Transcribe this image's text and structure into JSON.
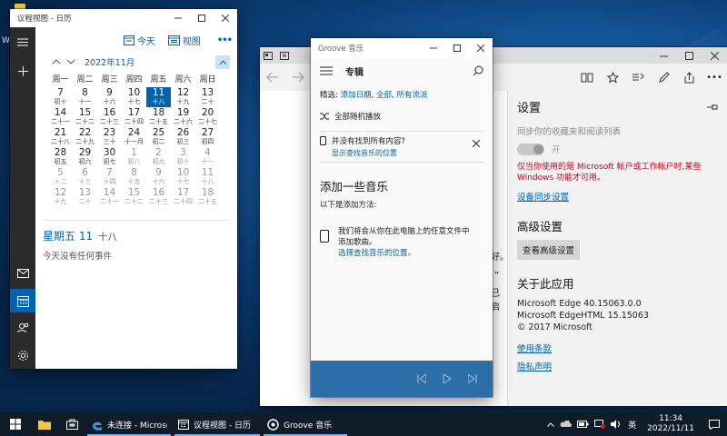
{
  "calendar": {
    "title": "议程视图 - 日历",
    "today_label": "今天",
    "view_label": "视图",
    "more": "•••",
    "month_label": "2022年11月",
    "weekdays": [
      "周一",
      "周二",
      "周三",
      "周四",
      "周五",
      "周六",
      "周日"
    ],
    "weeks": [
      [
        [
          "7",
          "初十",
          0
        ],
        [
          "8",
          "十一",
          0
        ],
        [
          "9",
          "十六",
          0
        ],
        [
          "10",
          "十七",
          0
        ],
        [
          "11",
          "十八",
          1
        ],
        [
          "12",
          "十九",
          0
        ],
        [
          "13",
          "二十",
          0
        ]
      ],
      [
        [
          "14",
          "二十一",
          0
        ],
        [
          "15",
          "二十二",
          0
        ],
        [
          "16",
          "二十三",
          0
        ],
        [
          "17",
          "二十四",
          0
        ],
        [
          "18",
          "二十五",
          0
        ],
        [
          "19",
          "二十六",
          0
        ],
        [
          "20",
          "二十七",
          0
        ]
      ],
      [
        [
          "21",
          "二十八",
          0
        ],
        [
          "22",
          "二十九",
          0
        ],
        [
          "23",
          "三十",
          0
        ],
        [
          "24",
          "十一月",
          0
        ],
        [
          "25",
          "初二",
          0
        ],
        [
          "26",
          "初三",
          0
        ],
        [
          "27",
          "初四",
          0
        ]
      ],
      [
        [
          "28",
          "初五",
          0
        ],
        [
          "29",
          "初六",
          0
        ],
        [
          "30",
          "初七",
          0
        ],
        [
          "1",
          "初八",
          2
        ],
        [
          "2",
          "初九",
          2
        ],
        [
          "3",
          "初十",
          2
        ],
        [
          "4",
          "十一",
          2
        ]
      ],
      [
        [
          "5",
          "十二",
          2
        ],
        [
          "6",
          "十三",
          2
        ],
        [
          "7",
          "十四",
          2
        ],
        [
          "8",
          "十五",
          2
        ],
        [
          "9",
          "十六",
          2
        ],
        [
          "10",
          "十七",
          2
        ],
        [
          "11",
          "十八",
          2
        ]
      ],
      [
        [
          "12",
          "十九",
          2
        ],
        [
          "13",
          "二十",
          2
        ],
        [
          "14",
          "二十一",
          2
        ],
        [
          "15",
          "二十二",
          2
        ],
        [
          "16",
          "二十三",
          2
        ],
        [
          "17",
          "二十四",
          2
        ],
        [
          "18",
          "二十五",
          2
        ]
      ]
    ],
    "selected_day_label": "星期五 11",
    "selected_lunar": "十八",
    "no_events": "今天没有任何事件"
  },
  "groove": {
    "title": "Groove 音乐",
    "header": "专辑",
    "filter_label": "精选:",
    "filter_links": [
      "添加日期",
      "全部",
      "所有流派"
    ],
    "shuffle": "全部随机播放",
    "notice_title": "并没有找到所有内容?",
    "notice_link": "显示查找音乐的位置",
    "add_title": "添加一些音乐",
    "add_sub": "以下是添加方法:",
    "add_text1": "我们将会从你在此电脑上的任意文件中",
    "add_text2": "添加歌曲。",
    "add_link": "选择查找音乐的位置。"
  },
  "edge": {
    "settings_title": "设置",
    "sync_label": "同步你的收藏夹和阅读列表",
    "toggle_label": "开",
    "warning": "仅当你使用的是 Microsoft 帐户或工作帐户时,某些 Windows 功能才可用。",
    "sync_settings_link": "设备同步设置",
    "advanced_title": "高级设置",
    "advanced_button": "查看高级设置",
    "about_title": "关于此应用",
    "version1": "Microsoft Edge 40.15063.0.0",
    "version2": "Microsoft EdgeHTML 15.15063",
    "copyright": "© 2017 Microsoft",
    "terms_link": "使用条款",
    "privacy_link": "隐私声明",
    "page_fragments": [
      "好。",
      "”",
      "已启"
    ]
  },
  "taskbar": {
    "edge_label": "未连接 - Microsof...",
    "calendar_label": "议程视图 - 日历",
    "groove_label": "Groove 音乐",
    "ime": "英",
    "time": "11:34",
    "date": "2022/11/11"
  },
  "desktop": {
    "label": "W"
  }
}
